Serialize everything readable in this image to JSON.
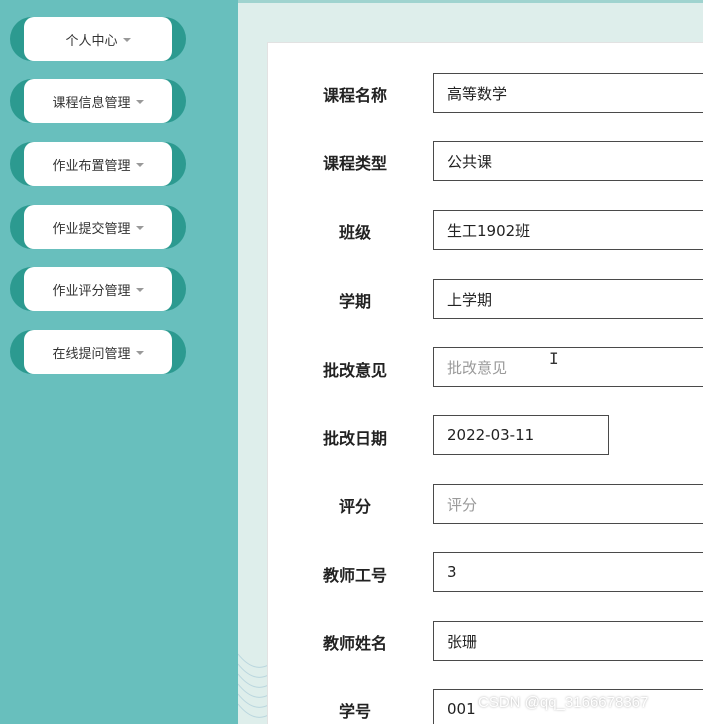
{
  "sidebar": {
    "items": [
      {
        "label": "个人中心"
      },
      {
        "label": "课程信息管理"
      },
      {
        "label": "作业布置管理"
      },
      {
        "label": "作业提交管理"
      },
      {
        "label": "作业评分管理"
      },
      {
        "label": "在线提问管理"
      }
    ]
  },
  "form": {
    "course_name": {
      "label": "课程名称",
      "value": "高等数学"
    },
    "course_type": {
      "label": "课程类型",
      "value": "公共课"
    },
    "class": {
      "label": "班级",
      "value": "生工1902班"
    },
    "semester": {
      "label": "学期",
      "value": "上学期"
    },
    "review_comment": {
      "label": "批改意见",
      "placeholder": "批改意见"
    },
    "review_date": {
      "label": "批改日期",
      "value": "2022-03-11"
    },
    "score": {
      "label": "评分",
      "placeholder": "评分"
    },
    "teacher_id": {
      "label": "教师工号",
      "value": "3"
    },
    "teacher_name": {
      "label": "教师姓名",
      "value": "张珊"
    },
    "student_id": {
      "label": "学号",
      "value": "001"
    }
  },
  "watermark": "CSDN @qq_3166678367",
  "colors": {
    "sidebar_bg": "#68bfbd",
    "nav_pill_edge": "#2c9a90",
    "main_bg": "#deeeeb"
  }
}
